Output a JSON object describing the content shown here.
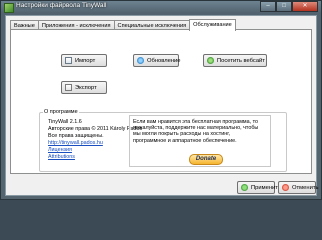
{
  "window": {
    "title": "Настройки файрвола TinyWall",
    "minimize": "–",
    "maximize": "□",
    "close": "✕"
  },
  "tabs": [
    {
      "label": "Важные"
    },
    {
      "label": "Приложения - исключения"
    },
    {
      "label": "Специальные исключения"
    },
    {
      "label": "Обслуживание"
    }
  ],
  "maintenance": {
    "import_label": "Импорт",
    "export_label": "Экспорт",
    "update_label": "Обновление",
    "website_label": "Посетить вебсайт"
  },
  "about": {
    "group_title": "О программе",
    "app_version": "TinyWall  2.1.6",
    "copyright": "Авторские права © 2011 Károly Pados",
    "rights": "Все права защищены.",
    "url": "http://tinywall.pados.hu",
    "license_link": "Лицензия",
    "attributions_link": "Attributions",
    "donate_lines": [
      "Если вам нравится эта бесплатная программа, то",
      "пожалуйста, поддержите нас материально, чтобы",
      "мы могли покрыть расходы на хостинг,",
      "программное и аппаратное обеспечение."
    ],
    "donate_button": "Donate"
  },
  "footer": {
    "apply_label": "Применить",
    "cancel_label": "Отменить"
  },
  "icons": {
    "import": "import-icon",
    "export": "export-icon",
    "update": "update-icon",
    "website": "globe-icon",
    "apply": "apply-icon",
    "cancel": "cancel-icon"
  }
}
